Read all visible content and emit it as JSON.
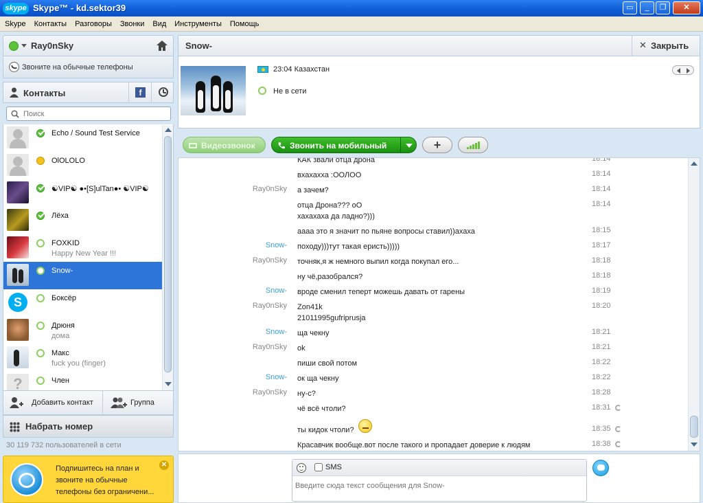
{
  "window": {
    "logo": "skype",
    "title": "Skype™ - kd.sektor39",
    "buttons": [
      "minimize-box",
      "minimize",
      "maximize",
      "close"
    ]
  },
  "menu": [
    "Skype",
    "Контакты",
    "Разговоры",
    "Звонки",
    "Вид",
    "Инструменты",
    "Помощь"
  ],
  "user": {
    "name": "Ray0nSky",
    "status": "online"
  },
  "call_phones": "Звоните на обычные телефоны",
  "contacts_header": {
    "title": "Контакты"
  },
  "search": {
    "placeholder": "Поиск"
  },
  "contacts": [
    {
      "name": "Echo / Sound Test Service",
      "mood": "",
      "status": "online"
    },
    {
      "name": "OlOLOLO",
      "mood": "",
      "status": "away"
    },
    {
      "name": "☯VIP☯ ●•[S]ulTan●• ☯VIP☯",
      "mood": "",
      "status": "online"
    },
    {
      "name": "Лёха",
      "mood": "",
      "status": "online"
    },
    {
      "name": "FOXKID",
      "mood": "Happy New Year !!!",
      "status": "offline"
    },
    {
      "name": "Snow-",
      "mood": "",
      "status": "offline"
    },
    {
      "name": "Боксёр",
      "mood": "",
      "status": "offline"
    },
    {
      "name": "Дрюня",
      "mood": "дома",
      "status": "offline"
    },
    {
      "name": "Макс",
      "mood": "fuck you (finger)",
      "status": "offline"
    },
    {
      "name": "Член",
      "mood": "",
      "status": "offline"
    }
  ],
  "add_contact": "Добавить контакт",
  "group": "Группа",
  "dial": "Набрать номер",
  "online_count": "30 119 732 пользователей в сети",
  "promo": "Подпишитесь на план и звоните на обычные телефоны без ограничени...",
  "chat": {
    "contact": "Snow-",
    "close": "Закрыть",
    "local_time": "23:04 Казахстан",
    "status": "Не в сети",
    "video_call": "Видеозвонок",
    "call_mobile": "Звонить на мобильный"
  },
  "messages": [
    {
      "who": "",
      "text": "КАК звали отца дрона",
      "time": "18:14"
    },
    {
      "who": "",
      "text": "вхахахха :ООЛОО",
      "time": "18:14"
    },
    {
      "who": "Ray0nSky",
      "text": "а зачем?",
      "time": "18:14"
    },
    {
      "who": "",
      "text": "отца Дрона??? оО",
      "text2": "хахахаха да ладно?)))",
      "time": "18:14"
    },
    {
      "who": "",
      "text": "аааа это я значит по пьяне вопросы ставил))ахаха",
      "time": "18:15"
    },
    {
      "who": "Snow-",
      "text": "походу)))тут такая еристь)))))",
      "time": "18:17"
    },
    {
      "who": "Ray0nSky",
      "text": "точняк,я ж немного выпил когда покупал его...",
      "time": "18:18"
    },
    {
      "who": "",
      "text": "ну чё,разобрался?",
      "time": "18:18"
    },
    {
      "who": "Snow-",
      "text": "вроде сменил теперт можешь давать от гарены",
      "time": "18:19"
    },
    {
      "who": "Ray0nSky",
      "text": "Zon41k",
      "text2": "21011995gufriprusja",
      "time": "18:20"
    },
    {
      "who": "Snow-",
      "text": "ща чекну",
      "time": "18:21"
    },
    {
      "who": "Ray0nSky",
      "text": "ok",
      "time": "18:21"
    },
    {
      "who": "",
      "text": "пиши свой потом",
      "time": "18:22"
    },
    {
      "who": "Snow-",
      "text": "ок ща чекну",
      "time": "18:22"
    },
    {
      "who": "Ray0nSky",
      "text": "ну-с?",
      "time": "18:28"
    },
    {
      "who": "",
      "text": "чё всё чтоли?",
      "time": "18:31"
    },
    {
      "who": "",
      "text": "ты кидок чтоли?",
      "time": "18:35"
    },
    {
      "who": "",
      "text": "Красавчик вообще.вот после такого и пропадает доверие к людям",
      "time": "18:38"
    }
  ],
  "compose": {
    "sms": "SMS",
    "placeholder": "Введите сюда текст сообщения для Snow-"
  }
}
